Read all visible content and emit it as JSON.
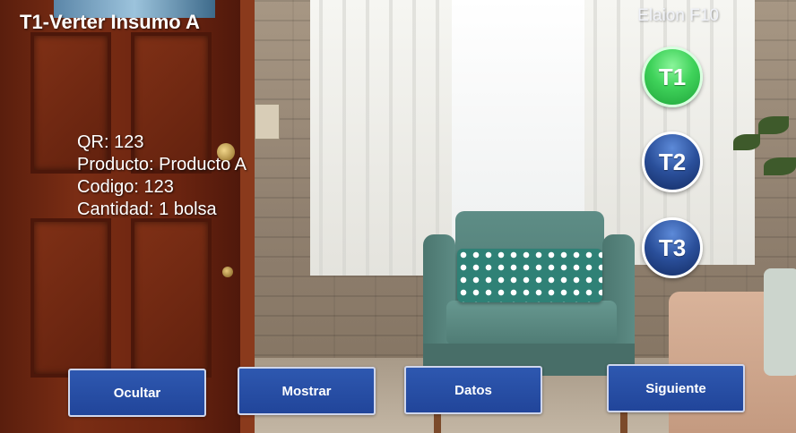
{
  "header": {
    "step_title": "T1-Verter Insumo A",
    "device_name": "Elaion F10"
  },
  "info": {
    "rows": [
      "QR: 123",
      "Producto: Producto A",
      "Codigo: 123",
      "Cantidad: 1 bolsa"
    ]
  },
  "task_buttons": [
    {
      "label": "T1",
      "state": "active"
    },
    {
      "label": "T2",
      "state": "inactive"
    },
    {
      "label": "T3",
      "state": "inactive"
    }
  ],
  "actions": {
    "hide_label": "Ocultar",
    "show_label": "Mostrar",
    "data_label": "Datos",
    "next_label": "Siguiente"
  },
  "colors": {
    "active_task": "#3fd25a",
    "inactive_task": "#2a4f9a",
    "action_button": "#2a52a8"
  }
}
